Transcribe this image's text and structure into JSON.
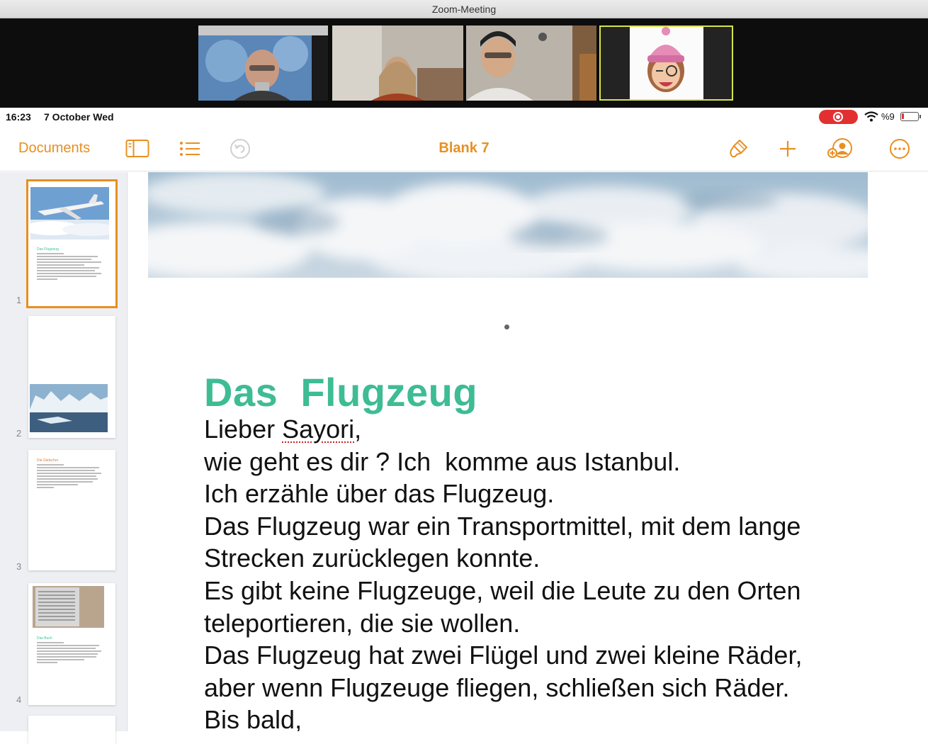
{
  "window": {
    "title": "Zoom-Meeting"
  },
  "participants": [
    {
      "name": "participant-1",
      "kind": "camera"
    },
    {
      "name": "participant-2",
      "kind": "camera"
    },
    {
      "name": "participant-3",
      "kind": "camera"
    },
    {
      "name": "participant-4",
      "kind": "memoji",
      "active_speaker": true
    }
  ],
  "status_bar": {
    "time": "16:23",
    "date": "7 October Wed",
    "battery": "%9",
    "recording": true
  },
  "toolbar": {
    "documents_label": "Documents",
    "title": "Blank 7",
    "icons_left": [
      "sidebar-icon",
      "list-icon",
      "undo-icon"
    ],
    "icons_right": [
      "paintbrush-icon",
      "plus-icon",
      "collaborate-icon",
      "more-icon"
    ],
    "accent": "#e88f21"
  },
  "navigator": {
    "pages": [
      {
        "number": "1",
        "selected": true
      },
      {
        "number": "2",
        "selected": false
      },
      {
        "number": "3",
        "selected": false
      },
      {
        "number": "4",
        "selected": false
      }
    ]
  },
  "document": {
    "heading": "Das  Flugzeug",
    "heading_color": "#3ebc94",
    "body": {
      "line1_prefix": "Lieber ",
      "line1_misspelled": "Sayori",
      "line1_suffix": ",",
      "line2": "wie geht es dir ? Ich  komme aus Istanbul.",
      "line3": "Ich erzähle über das Flugzeug.",
      "line4": "Das Flugzeug war ein Transportmittel, mit dem lange",
      "line5": "Strecken zurücklegen konnte.",
      "line6": "Es gibt keine Flugzeuge, weil die Leute zu den Orten",
      "line7": "teleportieren, die sie wollen.",
      "line8": "Das Flugzeug hat zwei Flügel und zwei kleine Räder,",
      "line9": "aber wenn Flugzeuge fliegen, schließen sich Räder.",
      "line10": "Bis bald,"
    }
  }
}
